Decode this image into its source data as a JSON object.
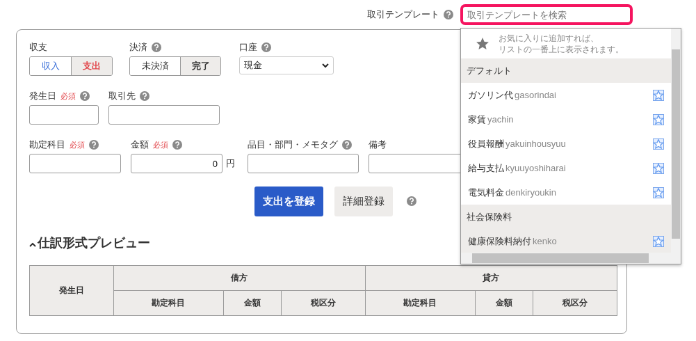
{
  "template_search": {
    "label": "取引テンプレート",
    "help": true,
    "placeholder": "取引テンプレートを検索"
  },
  "template_dropdown": {
    "hint": [
      "お気に入りに追加すれば、",
      "リストの一番上に表示されます。"
    ],
    "groups": [
      {
        "name": "デフォルト",
        "items": [
          {
            "name": "ガソリン代",
            "reading": "gasorindai",
            "selected": false
          },
          {
            "name": "家賃",
            "reading": "yachin",
            "selected": false
          },
          {
            "name": "役員報酬",
            "reading": "yakuinhousyuu",
            "selected": false
          },
          {
            "name": "給与支払",
            "reading": "kyuuyoshiharai",
            "selected": false
          },
          {
            "name": "電気料金",
            "reading": "denkiryoukin",
            "selected": false
          }
        ]
      },
      {
        "name": "社会保険料",
        "items": [
          {
            "name": "健康保険料納付",
            "reading": "kenko",
            "selected": true
          }
        ]
      }
    ]
  },
  "form_rows": [
    [
      {
        "kind": "toggle",
        "label": "収支",
        "help": false,
        "options": [
          {
            "label": "収入",
            "selected": false,
            "color": "#3a6fd8"
          },
          {
            "label": "支出",
            "selected": true,
            "color": "#e2454a"
          }
        ]
      },
      {
        "kind": "toggle",
        "label": "決済",
        "help": true,
        "options": [
          {
            "label": "未決済",
            "selected": false
          },
          {
            "label": "完了",
            "selected": true
          }
        ]
      },
      {
        "kind": "select",
        "label": "口座",
        "help": true,
        "value": "現金"
      }
    ],
    [
      {
        "kind": "text",
        "label": "発生日",
        "required": "必須",
        "help": true
      },
      {
        "kind": "text",
        "label": "取引先",
        "help": true
      }
    ],
    [
      {
        "kind": "text",
        "label": "勘定科目",
        "required": "必須",
        "help": true
      },
      {
        "kind": "amount",
        "label": "金額",
        "required": "必須",
        "help": true,
        "value": "0",
        "unit": "円"
      },
      {
        "kind": "text",
        "label": "品目・部門・メモタグ",
        "help": true
      },
      {
        "kind": "text",
        "label": "備考",
        "help": false
      }
    ]
  ],
  "actions": [
    {
      "kind": "primary",
      "label": "支出を登録"
    },
    {
      "kind": "secondary",
      "label": "詳細登録"
    }
  ],
  "actions_help": true,
  "preview": {
    "title": "仕訳形式プレビュー",
    "expanded": true,
    "columns": {
      "date": "発生日",
      "groups": [
        {
          "name": "借方",
          "columns": [
            "勘定科目",
            "金額",
            "税区分"
          ]
        },
        {
          "name": "貸方",
          "columns": [
            "勘定科目",
            "金額",
            "税区分"
          ]
        }
      ]
    }
  }
}
